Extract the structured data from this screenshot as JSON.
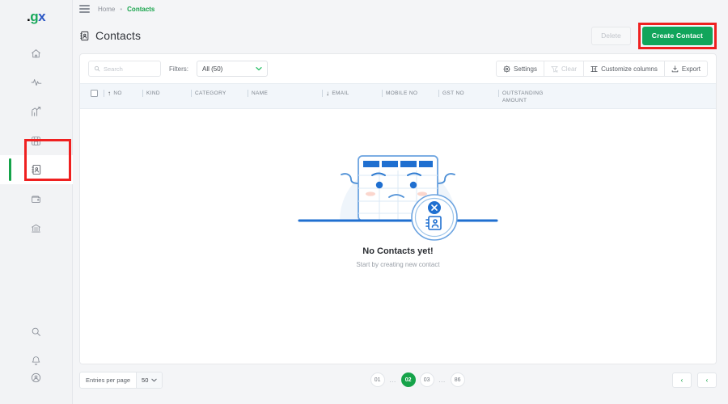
{
  "brand": {
    "logo_dot": ".",
    "logo_g": "g",
    "logo_x": "x",
    "accent_green": "#16a34a",
    "primary_green": "#11a55b",
    "highlight_red": "#ef2020"
  },
  "sidebar": {
    "items": [
      {
        "name": "home",
        "icon": "home-icon"
      },
      {
        "name": "activity",
        "icon": "pulse-icon"
      },
      {
        "name": "reports",
        "icon": "bar-chart-arrow-icon"
      },
      {
        "name": "inventory",
        "icon": "save-box-icon"
      },
      {
        "name": "contacts",
        "icon": "contact-book-icon",
        "active": true
      },
      {
        "name": "wallet",
        "icon": "wallet-icon"
      },
      {
        "name": "bank",
        "icon": "bank-icon"
      }
    ],
    "bottom_items": [
      {
        "name": "search",
        "icon": "search-icon"
      },
      {
        "name": "notifications",
        "icon": "bell-icon"
      },
      {
        "name": "account",
        "icon": "user-circle-icon"
      }
    ]
  },
  "topbar": {
    "menu_icon": "hamburger-icon",
    "breadcrumb": {
      "home": "Home",
      "separator": "•",
      "current": "Contacts"
    }
  },
  "pagehead": {
    "icon": "contact-book-icon",
    "title": "Contacts",
    "delete_label": "Delete",
    "create_label": "Create Contact"
  },
  "toolbar": {
    "search_placeholder": "Search",
    "search_value": "",
    "search_icon": "search-icon",
    "filters_label": "Filters:",
    "filter_value": "All (50)",
    "filter_chevron": "⌄",
    "settings_label": "Settings",
    "settings_icon": "gear-icon",
    "clear_label": "Clear",
    "clear_icon": "funnel-clear-icon",
    "customize_label": "Customize columns",
    "customize_icon": "columns-icon",
    "export_label": "Export",
    "export_icon": "download-icon"
  },
  "table": {
    "columns": [
      {
        "label": "NO",
        "sort": "↑"
      },
      {
        "label": "KIND",
        "sort": ""
      },
      {
        "label": "CATEGORY",
        "sort": ""
      },
      {
        "label": "NAME",
        "sort": ""
      },
      {
        "label": "EMAIL",
        "sort": "↓"
      },
      {
        "label": "MOBILE NO",
        "sort": ""
      },
      {
        "label": "GST NO",
        "sort": ""
      },
      {
        "label": "OUTSTANDING AMOUNT",
        "sort": ""
      }
    ],
    "rows": []
  },
  "empty_state": {
    "illustration": "sad-table-with-contact-badge-illustration",
    "title": "No Contacts yet!",
    "subtitle": "Start by creating new contact"
  },
  "pagination": {
    "entries_label": "Entries per page",
    "entries_value": "50",
    "entries_chevron": "⌄",
    "pages": [
      {
        "label": "01",
        "active": false
      },
      {
        "label": "…",
        "gap": true
      },
      {
        "label": "02",
        "active": true
      },
      {
        "label": "03",
        "active": false
      },
      {
        "label": "…",
        "gap": true
      },
      {
        "label": "86",
        "active": false
      }
    ],
    "prev_icon": "‹",
    "first_icon": "‹"
  }
}
